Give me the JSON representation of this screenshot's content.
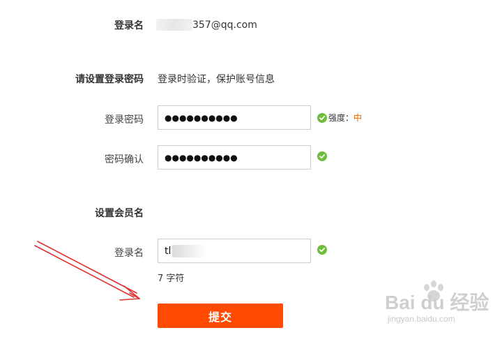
{
  "account": {
    "label": "登录名",
    "email_suffix": "357@qq.com"
  },
  "password_section": {
    "title": "请设置登录密码",
    "hint": "登录时验证，保护账号信息",
    "password_label": "登录密码",
    "password_value": "●●●●●●●●●●",
    "confirm_label": "密码确认",
    "confirm_value": "●●●●●●●●●●",
    "strength_label": "强度：",
    "strength_level": "中"
  },
  "member_section": {
    "title": "设置会员名",
    "login_label": "登录名",
    "login_value": "tl",
    "char_count": "7 字符"
  },
  "submit_label": "提交",
  "watermark": {
    "main": "Bai du 经验",
    "sub": "jingyan.baidu.com"
  },
  "colors": {
    "accent": "#ff4a00",
    "check": "#6fbd3c",
    "strength": "#e56600",
    "annotation_arrow": "#e03030"
  }
}
